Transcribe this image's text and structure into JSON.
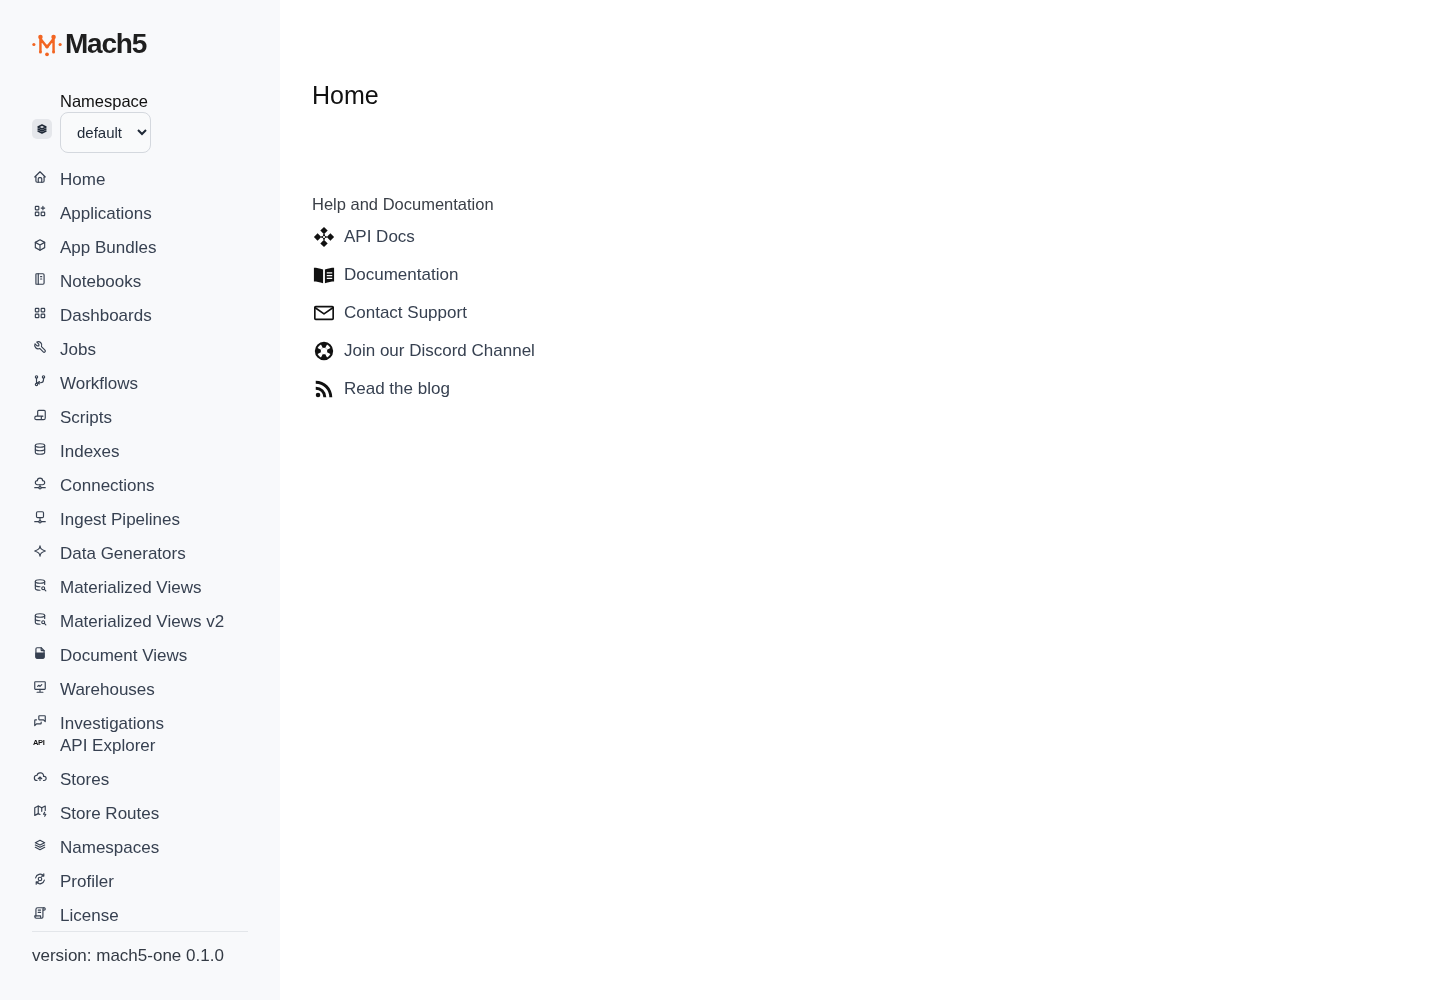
{
  "sidebar": {
    "logo": {
      "text": "Mach5"
    },
    "namespace": {
      "label": "Namespace",
      "value": "default"
    },
    "nav_items": [
      {
        "label": "Home"
      },
      {
        "label": "Applications"
      },
      {
        "label": "App Bundles"
      },
      {
        "label": "Notebooks"
      },
      {
        "label": "Dashboards"
      },
      {
        "label": "Jobs"
      },
      {
        "label": "Workflows"
      },
      {
        "label": "Scripts"
      },
      {
        "label": "Indexes"
      },
      {
        "label": "Connections"
      },
      {
        "label": "Ingest Pipelines"
      },
      {
        "label": "Data Generators"
      },
      {
        "label": "Materialized Views"
      },
      {
        "label": "Materialized Views v2"
      },
      {
        "label": "Document Views"
      },
      {
        "label": "Warehouses"
      },
      {
        "label": "Investigations"
      },
      {
        "label": "API Explorer",
        "icon_text": "API"
      },
      {
        "label": "Stores"
      },
      {
        "label": "Store Routes"
      },
      {
        "label": "Namespaces"
      },
      {
        "label": "Profiler"
      },
      {
        "label": "License"
      }
    ],
    "version": "version: mach5-one 0.1.0"
  },
  "main": {
    "title": "Home",
    "help": {
      "heading": "Help and Documentation",
      "links": [
        {
          "label": "API Docs"
        },
        {
          "label": "Documentation"
        },
        {
          "label": "Contact Support"
        },
        {
          "label": "Join our Discord Channel"
        },
        {
          "label": "Read the blog"
        }
      ]
    }
  }
}
